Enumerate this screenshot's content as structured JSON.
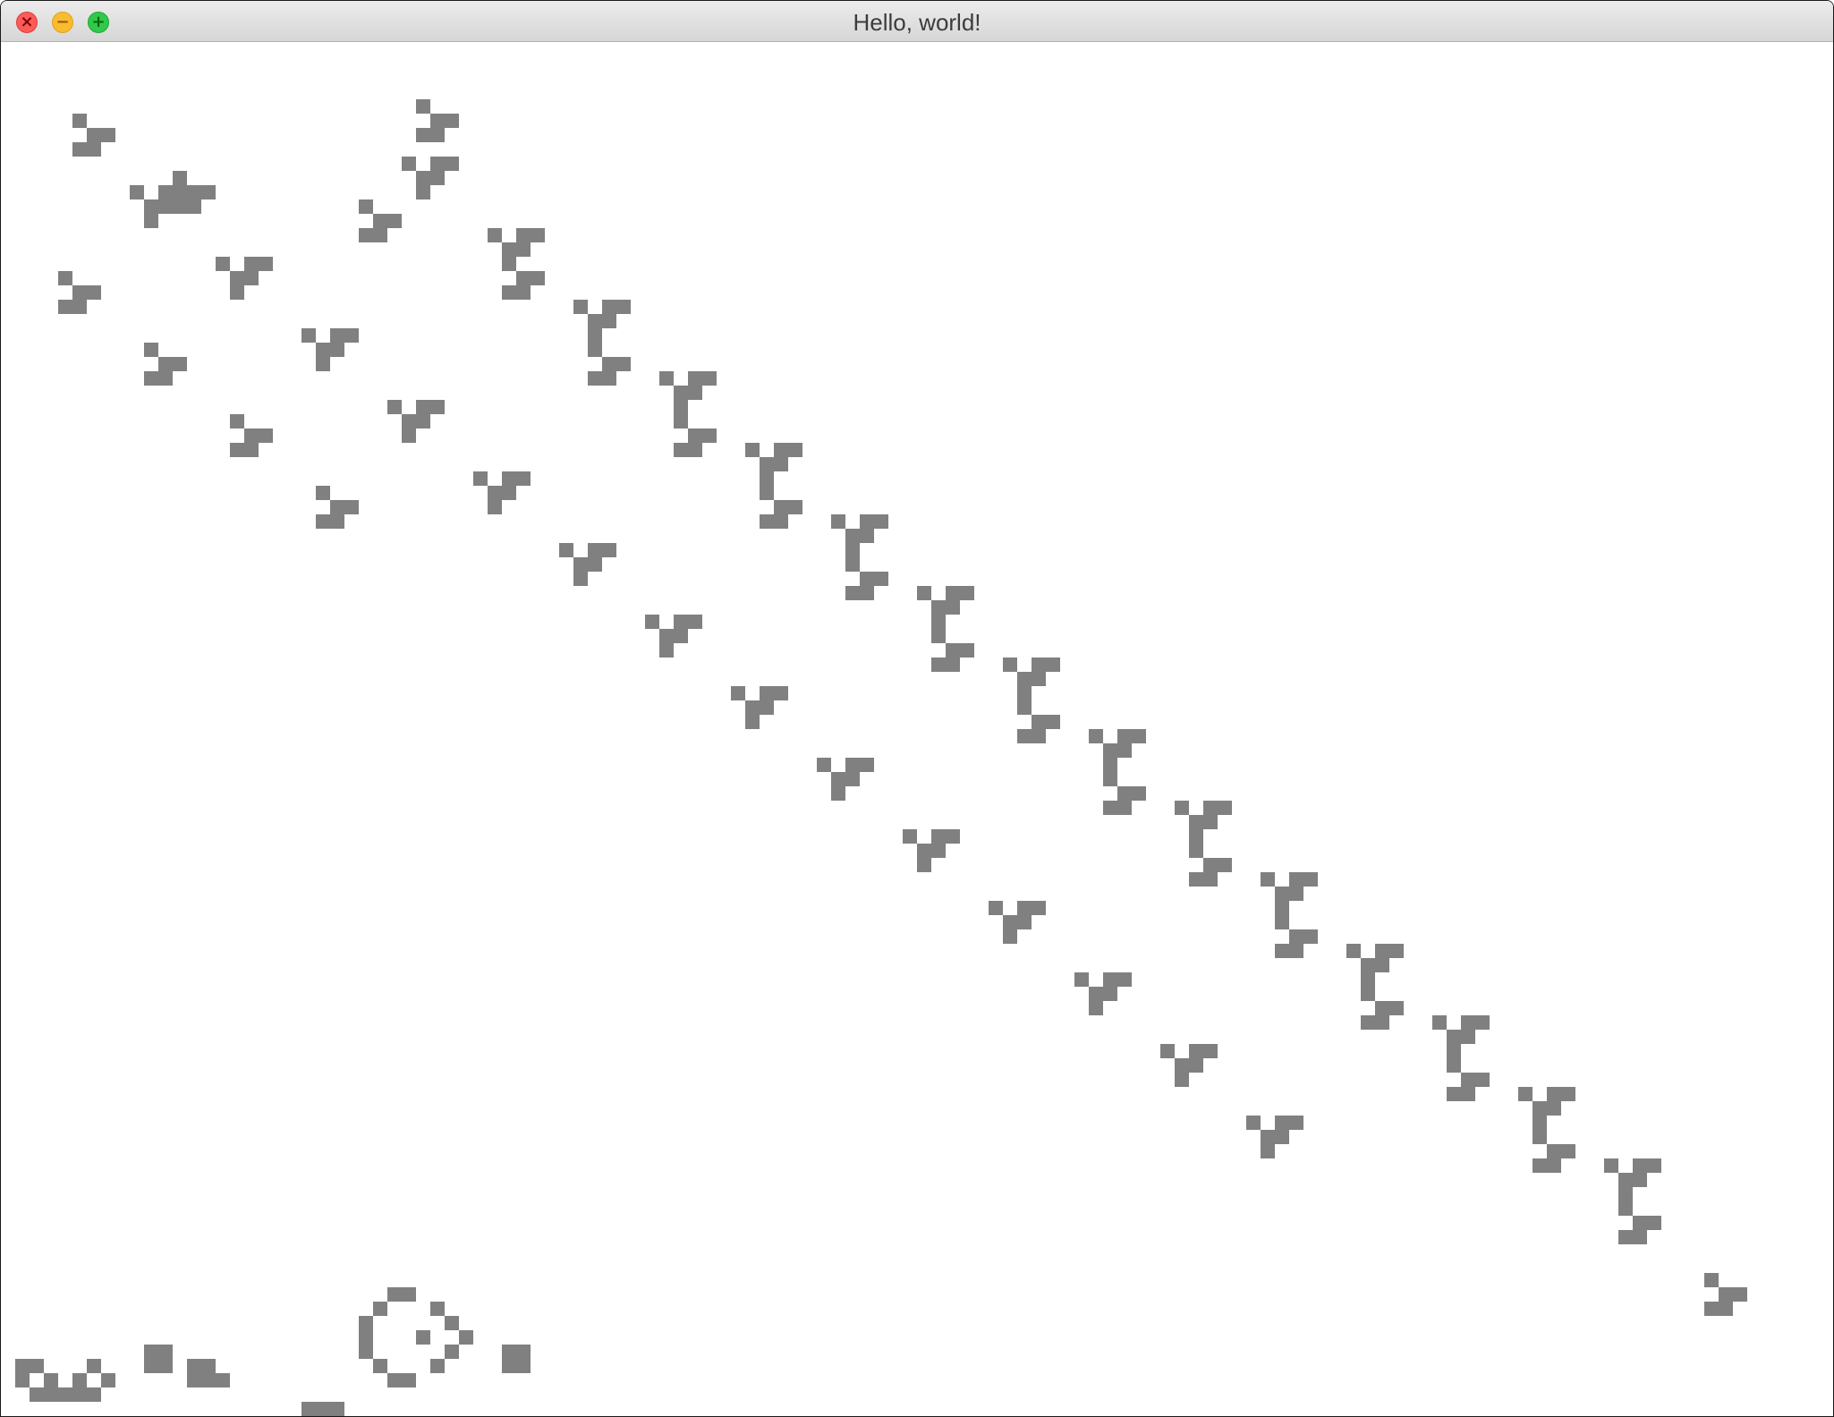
{
  "window": {
    "title": "Hello, world!",
    "buttons": {
      "close": "close-icon",
      "minimize": "minimize-icon",
      "zoom": "zoom-icon"
    }
  },
  "canvas": {
    "content": "Conway's Game of Life grid of live cells (gliders and gun pattern)",
    "cell_color": "#808080",
    "background_color": "#ffffff"
  },
  "colors": {
    "close": "#fc5b57",
    "minimize": "#f9bc2f",
    "zoom": "#30c949",
    "titlebar": "#e0e0e0"
  }
}
